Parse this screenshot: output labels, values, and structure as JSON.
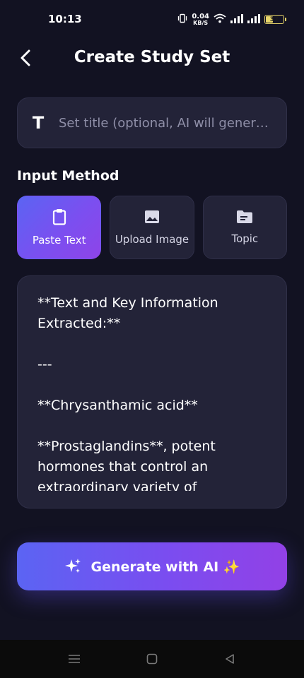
{
  "status_bar": {
    "time": "10:13",
    "net_speed_value": "0.04",
    "net_speed_unit": "KB/S",
    "battery_percent": "37",
    "battery_level": 0.37
  },
  "header": {
    "title": "Create Study Set",
    "back_icon": "chevron-left-icon"
  },
  "title_field": {
    "icon": "text-T-icon",
    "placeholder": "Set title (optional, AI will gener…",
    "value": ""
  },
  "input_method": {
    "label": "Input Method",
    "options": [
      {
        "label": "Paste Text",
        "icon": "clipboard-icon",
        "selected": true
      },
      {
        "label": "Upload Image",
        "icon": "image-icon",
        "selected": false
      },
      {
        "label": "Topic",
        "icon": "folder-icon",
        "selected": false
      }
    ]
  },
  "content": {
    "value": "**Text and Key Information Extracted:**\n\n---\n\n**Chrysanthamic acid**\n\n**Prostaglandins**, potent hormones that control an extraordinary variety of"
  },
  "generate_button": {
    "label": "Generate with AI ✨",
    "icon": "sparkles-icon"
  },
  "colors": {
    "background": "#121222",
    "card": "#232338",
    "accent_start": "#5b64f3",
    "accent_end": "#9241e6"
  }
}
